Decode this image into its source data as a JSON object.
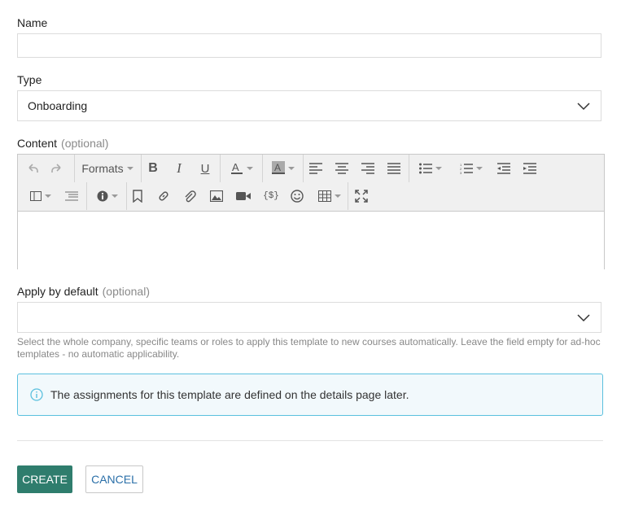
{
  "form": {
    "name_label": "Name",
    "name_value": "",
    "type_label": "Type",
    "type_value": "Onboarding",
    "content_label": "Content",
    "content_optional": "(optional)",
    "apply_label": "Apply by default",
    "apply_optional": "(optional)",
    "apply_value": "",
    "apply_help": "Select the whole company, specific teams or roles to apply this template to new courses automatically. Leave the field empty for ad-hoc templates - no automatic applicability.",
    "info_text": "The assignments for this template are defined on the details page later."
  },
  "editor": {
    "formats_label": "Formats",
    "toolbar_row1": [
      "undo-icon",
      "redo-icon",
      "formats-dropdown",
      "bold-icon",
      "italic-icon",
      "underline-icon",
      "text-color-icon",
      "background-color-icon",
      "align-left-icon",
      "align-center-icon",
      "align-right-icon",
      "align-justify-icon",
      "bullet-list-icon",
      "numbered-list-icon",
      "outdent-icon",
      "indent-icon"
    ],
    "toolbar_row2": [
      "layout-icon",
      "list-icon",
      "info-icon",
      "bookmark-icon",
      "link-icon",
      "attachment-icon",
      "image-icon",
      "video-icon",
      "variable-icon",
      "emoji-icon",
      "table-icon",
      "fullscreen-icon"
    ]
  },
  "actions": {
    "create_label": "CREATE",
    "cancel_label": "CANCEL"
  },
  "colors": {
    "primary": "#2f7d6d",
    "link": "#2a6fa8",
    "info_border": "#5bc0de",
    "info_bg": "#f2f9fc"
  }
}
